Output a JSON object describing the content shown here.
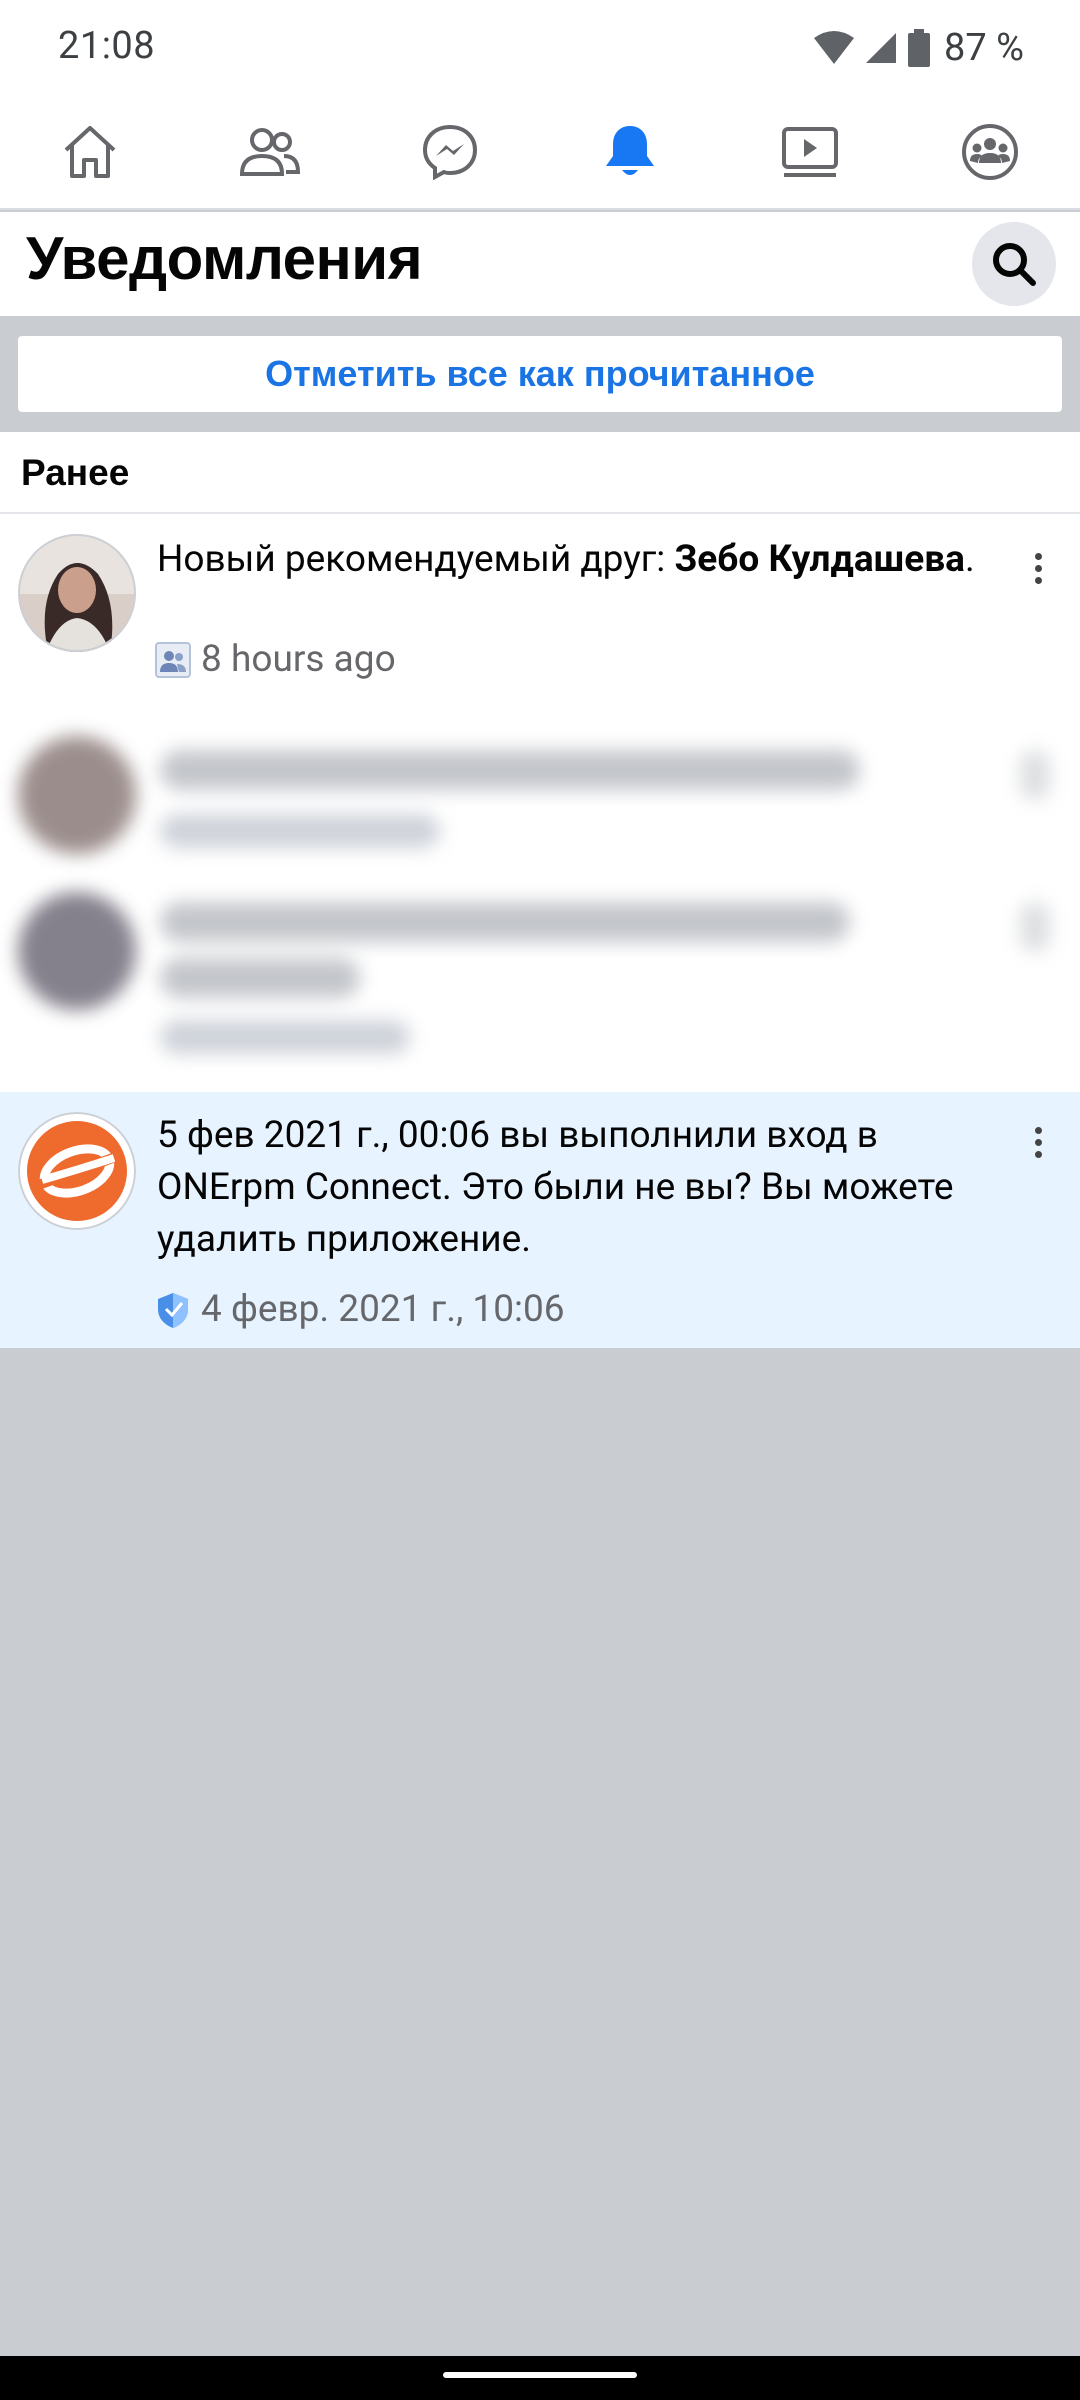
{
  "status_bar": {
    "time": "21:08",
    "battery": "87 %"
  },
  "nav": {
    "items": [
      {
        "name": "home",
        "icon": "home-icon"
      },
      {
        "name": "friends",
        "icon": "friends-icon"
      },
      {
        "name": "messenger",
        "icon": "messenger-icon"
      },
      {
        "name": "notifications",
        "icon": "bell-icon",
        "active": true
      },
      {
        "name": "watch",
        "icon": "video-icon"
      },
      {
        "name": "groups",
        "icon": "groups-icon"
      }
    ],
    "active_color": "#1877f2"
  },
  "header": {
    "title": "Уведомления"
  },
  "mark_all": {
    "label": "Отметить все как прочитанное"
  },
  "section": {
    "title": "Ранее"
  },
  "notifications": [
    {
      "text_prefix": "Новый рекомендуемый друг: ",
      "text_bold": "Зебо Кулдашева",
      "text_suffix": ".",
      "time": "8 hours ago",
      "icon": "friends-badge-icon"
    },
    {
      "text": "5 фев 2021 г., 00:06 вы выполнили вход в ONErpm Connect. Это были не вы? Вы можете удалить приложение.",
      "time": "4 февр. 2021 г., 10:06",
      "icon": "shield-badge-icon",
      "highlighted": true
    }
  ]
}
